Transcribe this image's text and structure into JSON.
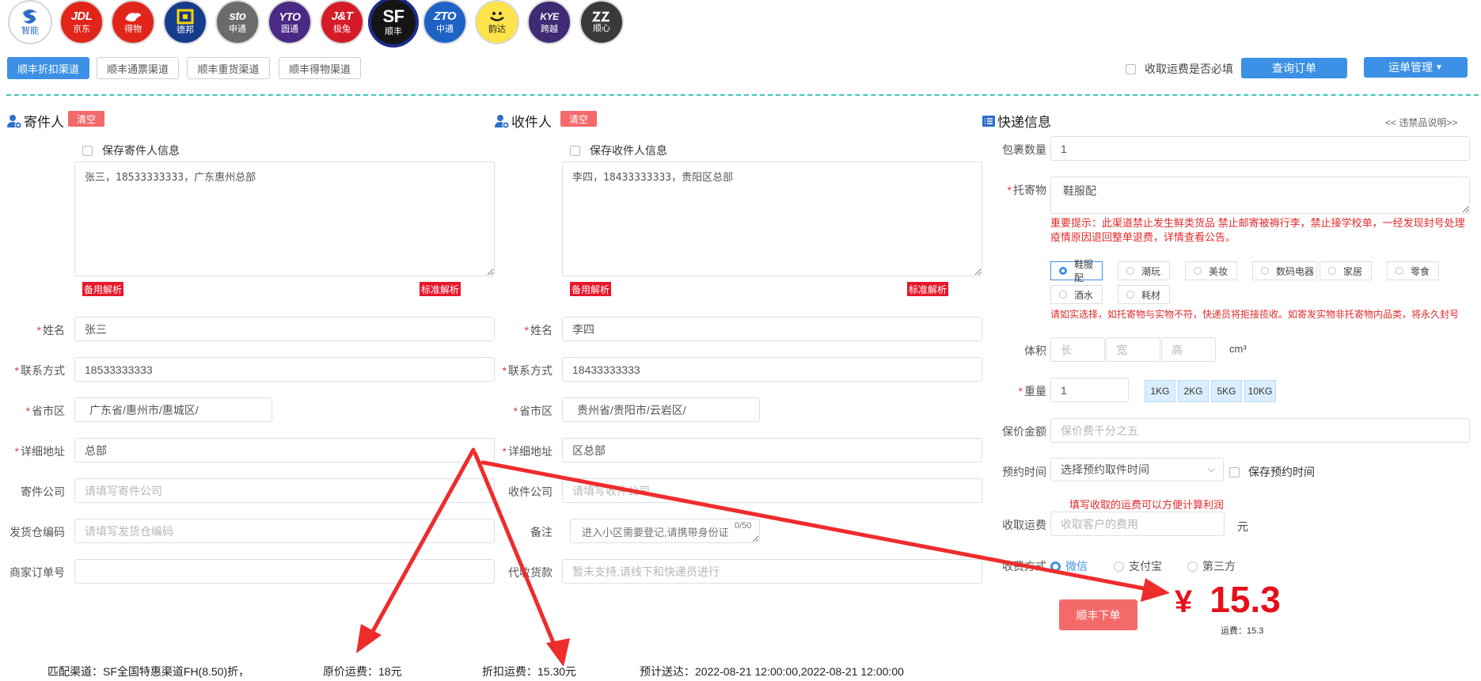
{
  "carriers": [
    {
      "mark": "",
      "name": "智能",
      "color": "#ffffff",
      "text": "#2f6bc6"
    },
    {
      "mark": "JDL",
      "name": "京东",
      "color": "#e1251b",
      "text": "#ffffff"
    },
    {
      "mark": "",
      "name": "得物",
      "color": "#e1251b",
      "text": "#ffffff"
    },
    {
      "mark": "",
      "name": "德邦",
      "color": "#163c8c",
      "text": "#ffffff"
    },
    {
      "mark": "sto",
      "name": "申通",
      "color": "#6b6b6b",
      "text": "#ffffff"
    },
    {
      "mark": "YTO",
      "name": "圆通",
      "color": "#4b2a86",
      "text": "#ffffff"
    },
    {
      "mark": "J&T",
      "name": "极兔",
      "color": "#d51b27",
      "text": "#ffffff"
    },
    {
      "mark": "SF",
      "name": "顺丰",
      "color": "#151515",
      "text": "#ffffff"
    },
    {
      "mark": "ZTO",
      "name": "中通",
      "color": "#1f62c6",
      "text": "#ffffff"
    },
    {
      "mark": "",
      "name": "韵达",
      "color": "#ffe34b",
      "text": "#222222"
    },
    {
      "mark": "KYE",
      "name": "跨越",
      "color": "#3f2a74",
      "text": "#ffffff"
    },
    {
      "mark": "",
      "name": "顺心",
      "color": "#3a3a3a",
      "text": "#ffffff"
    }
  ],
  "channels": [
    "顺丰折扣渠道",
    "顺丰通票渠道",
    "顺丰重货渠道",
    "顺丰得物渠道"
  ],
  "header": {
    "must_fill_label": "收取运费是否必填",
    "query_button": "查询订单",
    "manage_button": "运单管理"
  },
  "sender": {
    "title": "寄件人",
    "clear": "清空",
    "save_label": "保存寄件人信息",
    "paste_text": "张三，18533333333，广东惠州总部",
    "parse_backup": "备用解析",
    "parse_standard": "标准解析",
    "name_label": "姓名",
    "name_value": "张三",
    "phone_label": "联系方式",
    "phone_value": "18533333333",
    "region_label": "省市区",
    "region_value": "广东省/惠州市/惠城区/",
    "address_label": "详细地址",
    "address_value": "总部",
    "company_label": "寄件公司",
    "company_placeholder": "请填写寄件公司",
    "warehouse_label": "发货仓编码",
    "warehouse_placeholder": "请填写发货仓编码",
    "order_label": "商家订单号",
    "order_value": ""
  },
  "receiver": {
    "title": "收件人",
    "clear": "清空",
    "save_label": "保存收件人信息",
    "paste_text": "李四，18433333333，贵阳区总部",
    "parse_backup": "备用解析",
    "parse_standard": "标准解析",
    "name_label": "姓名",
    "name_value": "李四",
    "phone_label": "联系方式",
    "phone_value": "18433333333",
    "region_label": "省市区",
    "region_value": "贵州省/贵阳市/云岩区/",
    "address_label": "详细地址",
    "address_value": "区总部",
    "company_label": "收件公司",
    "company_placeholder": "请填写收件公司",
    "remark_label": "备注",
    "remark_placeholder": "进入小区需要登记,请携带身份证",
    "remark_count": "0/50",
    "cod_label": "代收货款",
    "cod_placeholder": "暂未支持,请线下和快递员进行"
  },
  "express": {
    "title": "快递信息",
    "banned_link": "<< 违禁品说明>>",
    "qty_label": "包裹数量",
    "qty_value": "1",
    "goods_label": "托寄物",
    "goods_value": "鞋服配",
    "notice": "重要提示：此渠道禁止发生鲜类货品 禁止邮寄被褥行李，禁止接学校单，一经发现封号处理",
    "notice2": "疫情原因退回整单退费，详情查看公告。",
    "categories": [
      "鞋服配",
      "潮玩",
      "美妆",
      "数码电器",
      "家居",
      "零食",
      "酒水",
      "耗材"
    ],
    "category_warning": "请如实选择，如托寄物与实物不符，快递员将拒接揽收。如寄发实物非托寄物内品类，将永久封号",
    "volume_label": "体积",
    "volume_l": "长",
    "volume_w": "宽",
    "volume_h": "高",
    "volume_unit": "cm³",
    "weight_label": "重量",
    "weight_value": "1",
    "weight_presets": [
      "1KG",
      "2KG",
      "5KG",
      "10KG"
    ],
    "insured_label": "保价金额",
    "insured_placeholder": "保价费千分之五",
    "booking_label": "预约时间",
    "booking_select": "选择预约取件时间",
    "booking_save": "保存预约时间",
    "fee_hint": "填写收取的运费可以方便计算利润",
    "fee_label": "收取运费",
    "fee_placeholder": "收取客户的费用",
    "fee_unit": "元",
    "pay_label": "收费方式",
    "pay_options": [
      "微信",
      "支付宝",
      "第三方"
    ],
    "submit": "顺丰下单",
    "price_symbol": "¥",
    "price_value": "15.3",
    "freight_label": "运费：15.3"
  },
  "footer": {
    "channel": "匹配渠道：SF全国特惠渠道FH(8.50)折，",
    "original": "原价运费：18元",
    "discount": "折扣运费：15.30元",
    "eta": "预计送达：2022-08-21 12:00:00,2022-08-21 12:00:00"
  },
  "colors": {
    "accent": "#3c91e6",
    "danger": "#f46a6a",
    "annotation": "#ee2c2c"
  }
}
